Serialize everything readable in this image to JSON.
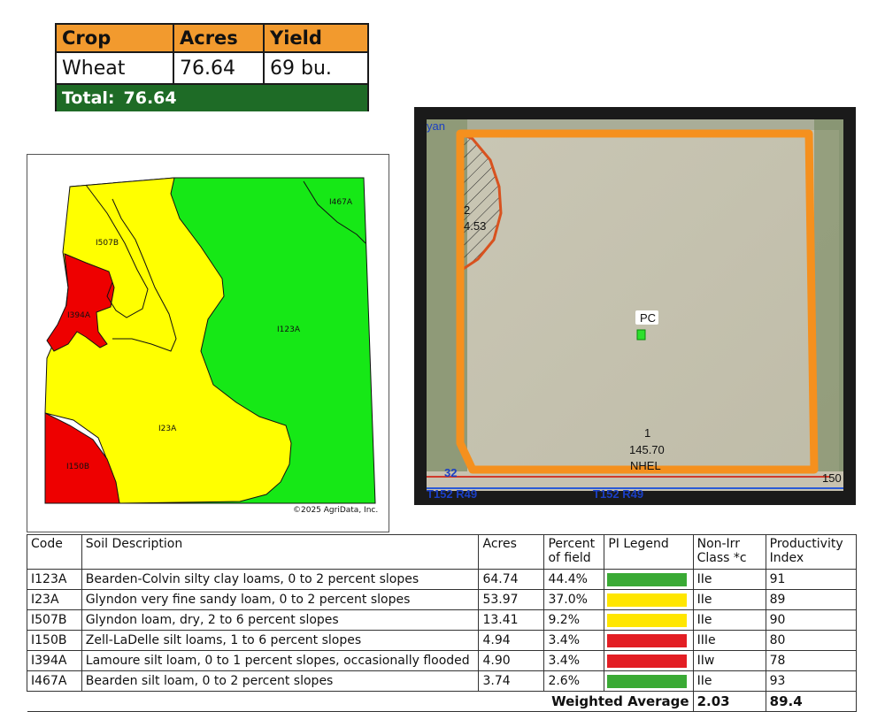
{
  "crop_table": {
    "headers": [
      "Crop",
      "Acres",
      "Yield"
    ],
    "rows": [
      [
        "Wheat",
        "76.64",
        "69 bu."
      ]
    ],
    "total_label": "Total:",
    "total_value": "76.64",
    "header_color": "#f29a2e",
    "total_color": "#1e6b26"
  },
  "soil_map": {
    "labels": {
      "l1467a": "I467A",
      "l1507b": "I507B",
      "l1394a": "I394A",
      "l1123a": "I123A",
      "l123a": "I23A",
      "l1150b": "I150B"
    },
    "copyright": "©2025 AgriData, Inc.",
    "colors": {
      "green": "#16e816",
      "yellow": "#ffff00",
      "red": "#ee0000"
    }
  },
  "aerial_map": {
    "field_2_number": "2",
    "field_2_acres": "4.53",
    "field_1_number": "1",
    "field_1_acres": "145.70",
    "field_1_class": "NHEL",
    "pc_label": "PC",
    "road_32": "32",
    "township_left": "T152 R49",
    "township_right": "T152 R49",
    "edge_150": "150",
    "top_left_fragment": "yan",
    "boundary_color": "#f5901e"
  },
  "soil_table": {
    "headers": {
      "code": "Code",
      "desc": "Soil Description",
      "acres": "Acres",
      "percent": "Percent of field",
      "pi_legend": "PI Legend",
      "nonirr": "Non-Irr Class *c",
      "pi": "Productivity Index"
    },
    "rows": [
      {
        "code": "I123A",
        "desc": "Bearden-Colvin silty clay loams, 0 to 2 percent slopes",
        "acres": "64.74",
        "percent": "44.4%",
        "color": "#3aaa35",
        "nonirr": "IIe",
        "pi": "91"
      },
      {
        "code": "I23A",
        "desc": "Glyndon very fine sandy loam, 0 to 2 percent slopes",
        "acres": "53.97",
        "percent": "37.0%",
        "color": "#ffe600",
        "nonirr": "IIe",
        "pi": "89"
      },
      {
        "code": "I507B",
        "desc": "Glyndon loam, dry, 2 to 6 percent slopes",
        "acres": "13.41",
        "percent": "9.2%",
        "color": "#ffe600",
        "nonirr": "IIe",
        "pi": "90"
      },
      {
        "code": "I150B",
        "desc": "Zell-LaDelle silt loams, 1 to 6 percent slopes",
        "acres": "4.94",
        "percent": "3.4%",
        "color": "#e31e24",
        "nonirr": "IIIe",
        "pi": "80"
      },
      {
        "code": "I394A",
        "desc": "Lamoure silt loam, 0 to 1 percent slopes, occasionally flooded",
        "acres": "4.90",
        "percent": "3.4%",
        "color": "#e31e24",
        "nonirr": "IIw",
        "pi": "78"
      },
      {
        "code": "I467A",
        "desc": "Bearden silt loam, 0 to 2 percent slopes",
        "acres": "3.74",
        "percent": "2.6%",
        "color": "#3aaa35",
        "nonirr": "IIe",
        "pi": "93"
      }
    ],
    "weighted_average_label": "Weighted Average",
    "weighted_class": "2.03",
    "weighted_pi": "89.4"
  }
}
